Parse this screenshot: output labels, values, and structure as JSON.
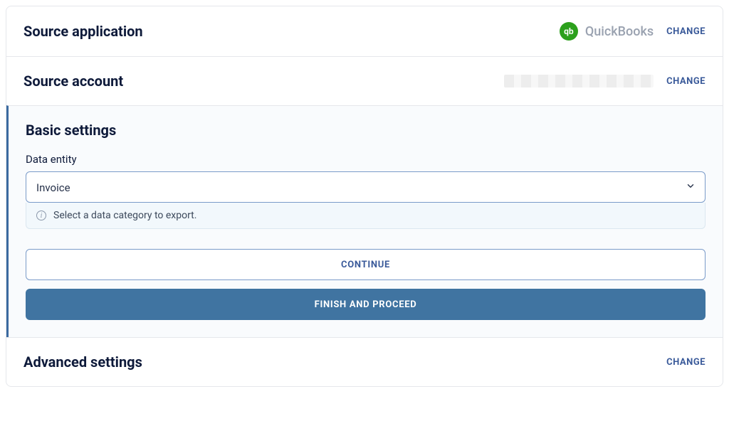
{
  "sourceApplication": {
    "title": "Source application",
    "app_name": "QuickBooks",
    "icon_glyph": "qb",
    "change_label": "CHANGE"
  },
  "sourceAccount": {
    "title": "Source account",
    "change_label": "CHANGE"
  },
  "basicSettings": {
    "title": "Basic settings",
    "data_entity_label": "Data entity",
    "data_entity_value": "Invoice",
    "helper_text": "Select a data category to export.",
    "continue_label": "CONTINUE",
    "finish_label": "FINISH AND PROCEED"
  },
  "advancedSettings": {
    "title": "Advanced settings",
    "change_label": "CHANGE"
  }
}
